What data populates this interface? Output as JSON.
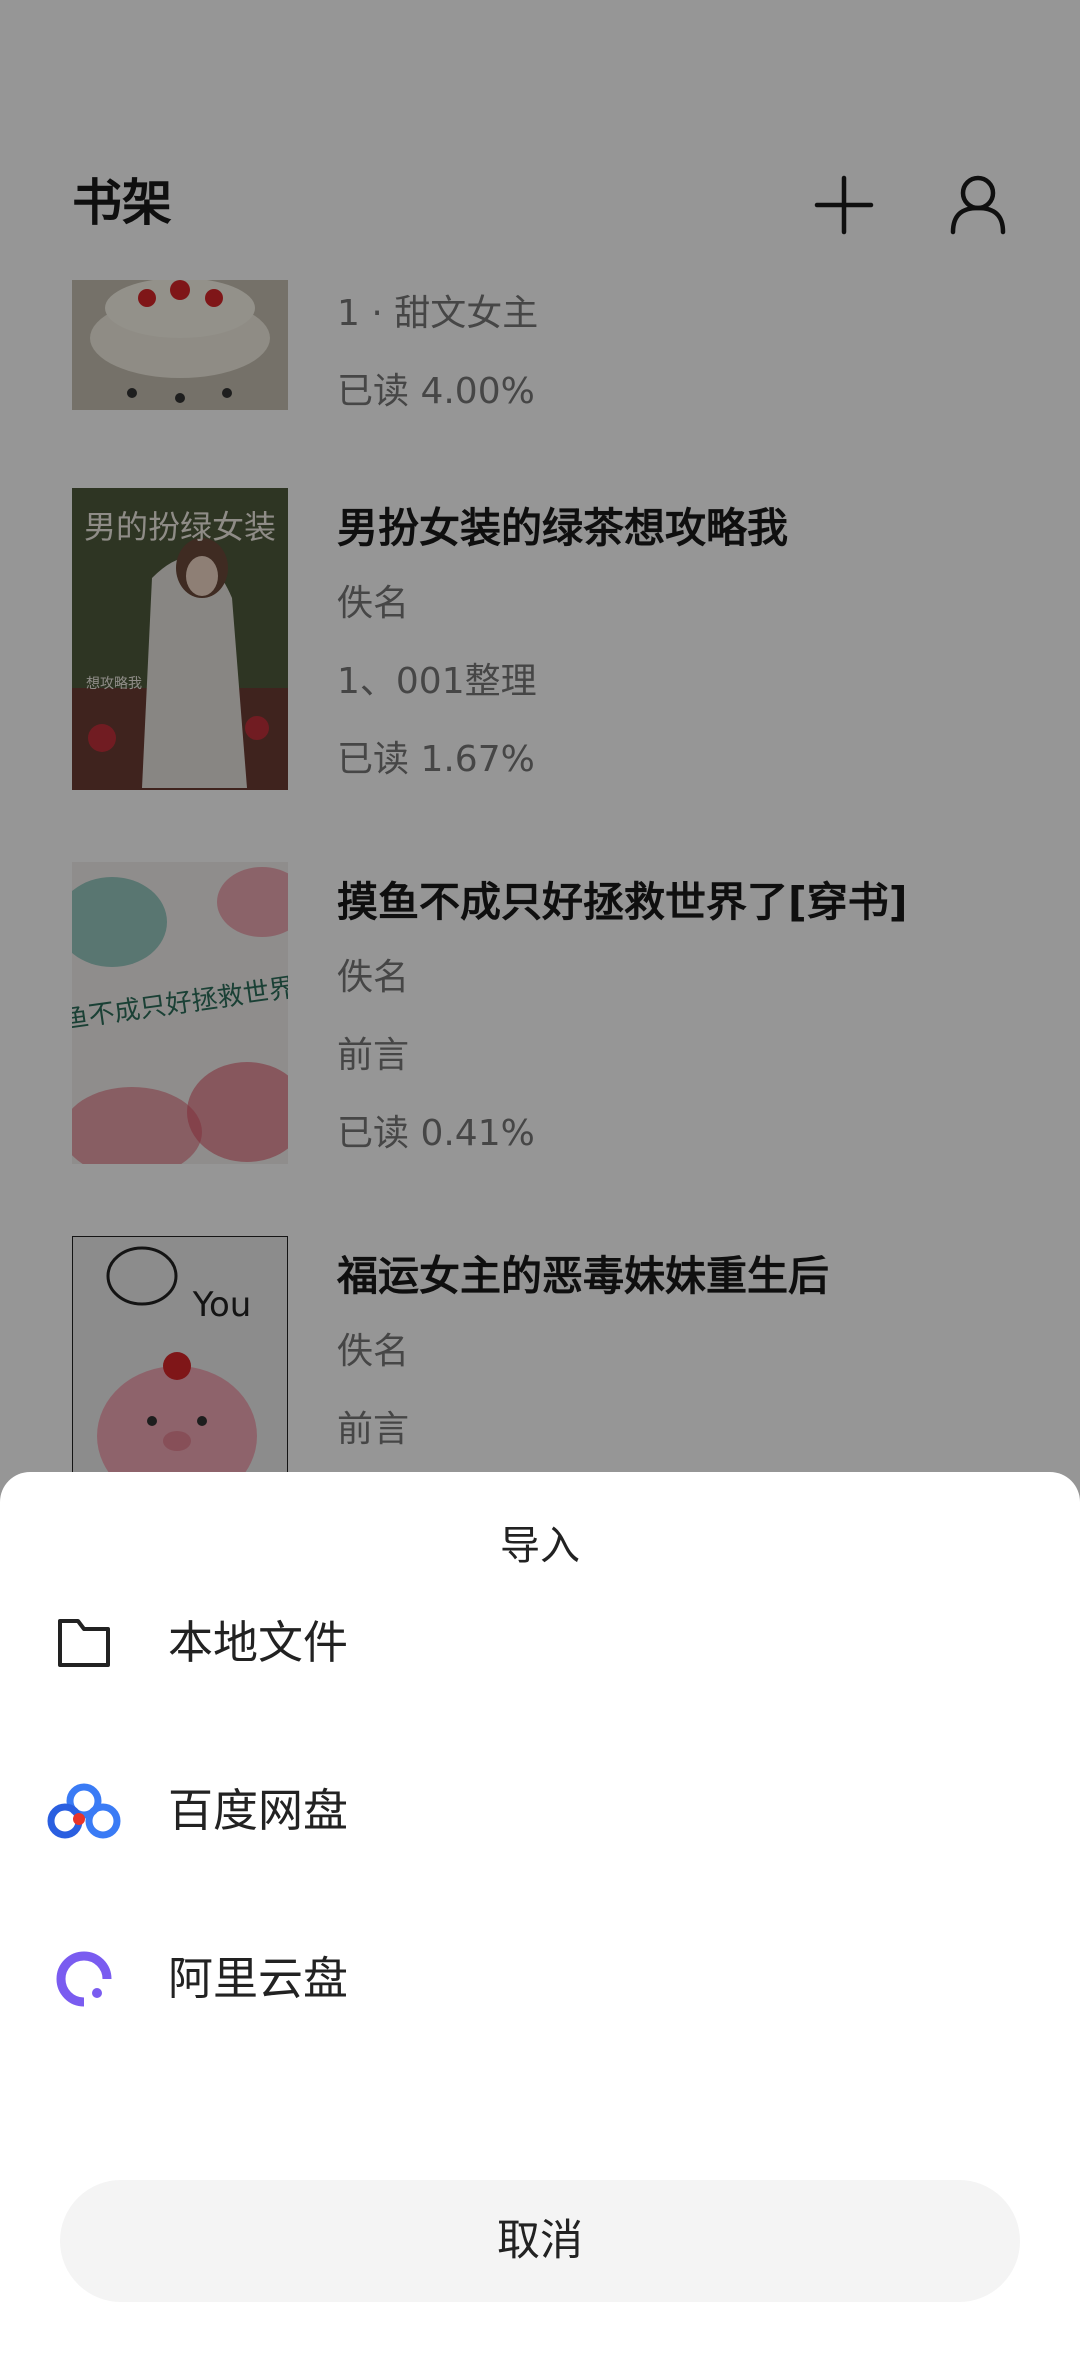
{
  "header": {
    "title": "书架",
    "add_icon": "plus-icon",
    "user_icon": "user-icon"
  },
  "books": [
    {
      "title": "",
      "author": "",
      "chapter": "1 · 甜文女主",
      "progress": "已读 4.00%",
      "cover": "cake-photo"
    },
    {
      "title": "男扮女装的绿茶想攻略我",
      "author": "佚名",
      "chapter": "1、001整理",
      "progress": "已读 1.67%",
      "cover": "anime-girl-cover",
      "cover_text": "男的扮绿女装",
      "cover_subtext": "想攻略我"
    },
    {
      "title": "摸鱼不成只好拯救世界了[穿书]",
      "author": "佚名",
      "chapter": "前言",
      "progress": "已读 0.41%",
      "cover": "watercolor-calligraphy-cover",
      "cover_text": "摸鱼不成只好拯救世界了"
    },
    {
      "title": "福运女主的恶毒妹妹重生后",
      "author": "佚名",
      "chapter": "前言",
      "progress": "",
      "cover": "pink-pig-plush-cover",
      "cover_text": "You"
    }
  ],
  "import_sheet": {
    "title": "导入",
    "options": [
      {
        "label": "本地文件",
        "icon": "folder-icon"
      },
      {
        "label": "百度网盘",
        "icon": "baidu-netdisk-icon",
        "color": "#2f6bf0"
      },
      {
        "label": "阿里云盘",
        "icon": "aliyun-drive-icon",
        "color": "#7a5cf0"
      }
    ],
    "cancel_label": "取消"
  },
  "colors": {
    "overlay": "rgba(0,0,0,0.41)",
    "sheet_background": "#ffffff",
    "cancel_background": "#f4f4f4"
  }
}
